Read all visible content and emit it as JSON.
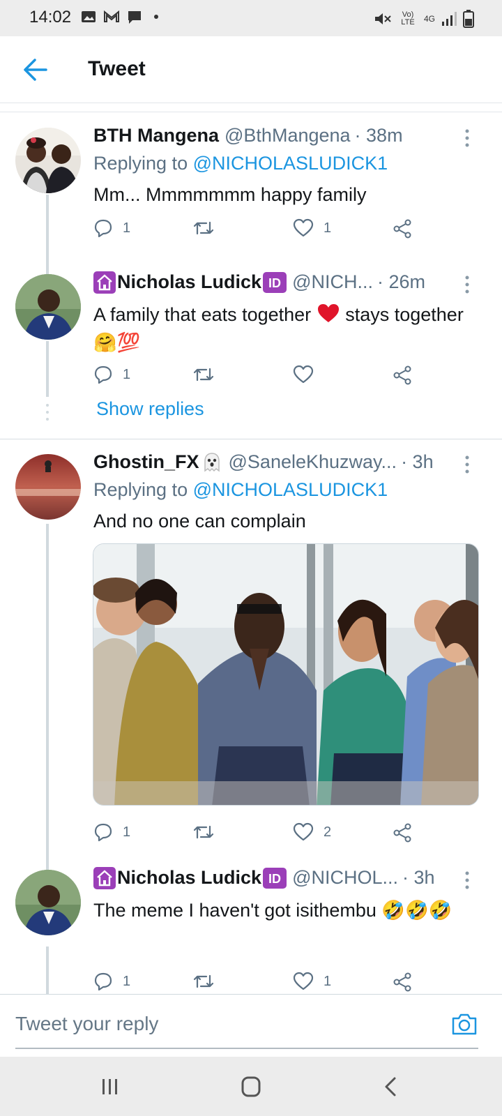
{
  "status_bar": {
    "time": "14:02",
    "network": "Vo) LTE",
    "network_type": "4G",
    "icons": [
      "image-icon",
      "gmail-icon",
      "chat-icon",
      "dot-icon",
      "mute-icon",
      "signal-icon",
      "battery-icon"
    ]
  },
  "header": {
    "title": "Tweet",
    "back_icon": "back-arrow-icon"
  },
  "colors": {
    "accent": "#1b95e0",
    "muted": "#5b7083",
    "text": "#14171a",
    "divider": "#d7dde2"
  },
  "tweets": [
    {
      "name": "BTH Mangena",
      "handle": "@BthMangena",
      "time": "· 38m",
      "replying_label": "Replying to",
      "replying_to": "@NICHOLASLUDICK1",
      "text": "Mm... Mmmmmmm happy family",
      "replies": "1",
      "retweets": "",
      "likes": "1"
    },
    {
      "name": "Nicholas Ludick",
      "handle": "@NICH...",
      "time": "· 26m",
      "text_a": "A family that eats together",
      "text_b": "stays together",
      "emoji_tail": "🤗💯",
      "replies": "1",
      "retweets": "",
      "likes": "",
      "show_replies": "Show replies"
    },
    {
      "name": "Ghostin_FX",
      "handle": "@SaneleKhuzway...",
      "time": "· 3h",
      "replying_label": "Replying to",
      "replying_to": "@NICHOLASLUDICK1",
      "text": "And no one can complain",
      "replies": "1",
      "retweets": "",
      "likes": "2"
    },
    {
      "name": "Nicholas Ludick",
      "handle": "@NICHOL...",
      "time": "· 3h",
      "text": "The meme I haven't got isithembu 🤣🤣🤣",
      "replies": "1",
      "retweets": "",
      "likes": "1"
    }
  ],
  "reply_bar": {
    "placeholder": "Tweet your reply",
    "camera_icon": "camera-icon"
  },
  "nav_bar": {
    "buttons": [
      "recents-icon",
      "home-icon",
      "back-icon"
    ]
  }
}
